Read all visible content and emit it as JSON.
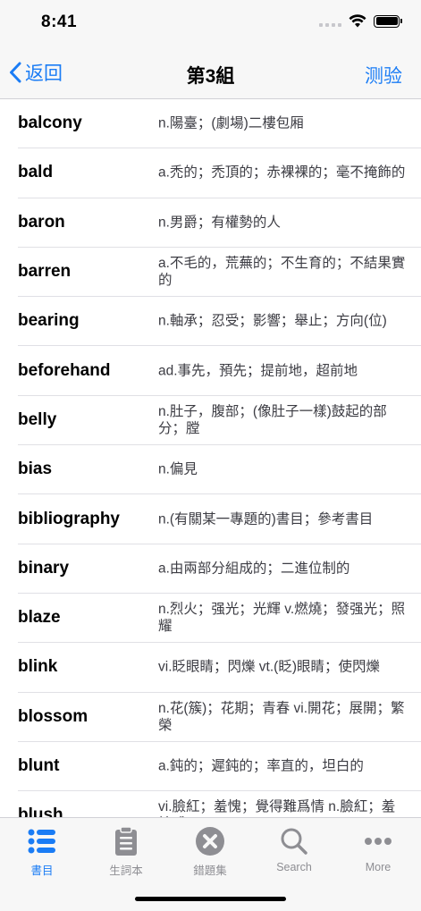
{
  "status": {
    "time": "8:41"
  },
  "nav": {
    "back_label": "返回",
    "title": "第3組",
    "right_label": "测验"
  },
  "words": [
    {
      "word": "balcony",
      "meaning": "n.陽臺；(劇場)二樓包厢"
    },
    {
      "word": "bald",
      "meaning": "a.禿的；禿頂的；赤裸裸的；毫不掩飾的"
    },
    {
      "word": "baron",
      "meaning": "n.男爵；有權勢的人"
    },
    {
      "word": "barren",
      "meaning": "a.不毛的，荒蕪的；不生育的；不結果實的"
    },
    {
      "word": "bearing",
      "meaning": "n.軸承；忍受；影響；舉止；方向(位)"
    },
    {
      "word": "beforehand",
      "meaning": "ad.事先，預先；提前地，超前地"
    },
    {
      "word": "belly",
      "meaning": "n.肚子，腹部；(像肚子一樣)鼓起的部分；膛"
    },
    {
      "word": "bias",
      "meaning": "n.偏見"
    },
    {
      "word": "bibliography",
      "meaning": "n.(有關某一專題的)書目；參考書目"
    },
    {
      "word": "binary",
      "meaning": "a.由兩部分組成的；二進位制的"
    },
    {
      "word": "blaze",
      "meaning": "n.烈火；强光；光輝 v.燃燒；發强光；照耀"
    },
    {
      "word": "blink",
      "meaning": "vi.眨眼睛；閃爍 vt.(眨)眼睛；使閃爍"
    },
    {
      "word": "blossom",
      "meaning": "n.花(簇)；花期；青春 vi.開花；展開；繁榮"
    },
    {
      "word": "blunt",
      "meaning": "a.鈍的；遲鈍的；率直的，坦白的"
    },
    {
      "word": "blush",
      "meaning": "vi.臉紅；羞愧；覺得難爲情 n.臉紅；羞愧感"
    }
  ],
  "tabs": [
    {
      "label": "書目",
      "icon": "list-icon",
      "active": true
    },
    {
      "label": "生詞本",
      "icon": "clipboard-icon",
      "active": false
    },
    {
      "label": "錯題集",
      "icon": "x-circle-icon",
      "active": false
    },
    {
      "label": "Search",
      "icon": "search-icon",
      "active": false
    },
    {
      "label": "More",
      "icon": "more-icon",
      "active": false
    }
  ],
  "colors": {
    "accent": "#1a7cf5",
    "inactive": "#8e8e93"
  }
}
